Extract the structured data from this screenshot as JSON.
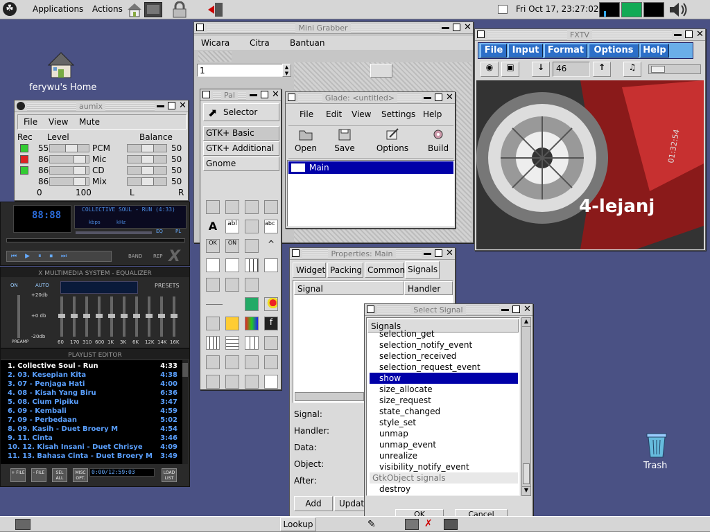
{
  "top_panel": {
    "applications": "Applications",
    "actions": "Actions",
    "clock": "Fri Oct 17, 23:27:02"
  },
  "desktop": {
    "home_label": "ferywu's Home",
    "trash_label": "Trash"
  },
  "aumix": {
    "title": "aumix",
    "menu": [
      "File",
      "View",
      "Mute"
    ],
    "headers": {
      "rec": "Rec",
      "level": "Level",
      "balance": "Balance"
    },
    "channels": [
      {
        "level": "55",
        "name": "PCM",
        "balance": "50"
      },
      {
        "level": "86",
        "name": "Mic",
        "balance": "50"
      },
      {
        "level": "86",
        "name": "CD",
        "balance": "50"
      },
      {
        "level": "86",
        "name": "Mix",
        "balance": "50"
      }
    ],
    "scale": {
      "min": "0",
      "max": "100",
      "left": "L",
      "right": "R"
    }
  },
  "xmms": {
    "song": "COLLECTIVE SOUL - RUN (4:33)",
    "kbps": "kbps",
    "khz": "kHz",
    "eq": "EQ",
    "pl": "PL",
    "band": "BAND",
    "rep": "REP",
    "eq_title": "X MULTIMEDIA SYSTEM - EQUALIZER",
    "on": "ON",
    "auto": "AUTO",
    "presets": "PRESETS",
    "db_top": "+20db",
    "db_mid": "+0 db",
    "db_bot": "-20db",
    "preamp": "PREAMP",
    "bands": [
      "60",
      "170",
      "310",
      "600",
      "1K",
      "3K",
      "6K",
      "12K",
      "14K",
      "16K"
    ],
    "pl_title": "PLAYLIST EDITOR",
    "playlist": [
      {
        "t": "1. Collective Soul - Run",
        "d": "4:33"
      },
      {
        "t": "2. 03. Kesepian Kita",
        "d": "4:38"
      },
      {
        "t": "3. 07 - Penjaga Hati",
        "d": "4:00"
      },
      {
        "t": "4. 08 - Kisah Yang Biru",
        "d": "6:36"
      },
      {
        "t": "5. 08. Cium Pipiku",
        "d": "3:47"
      },
      {
        "t": "6. 09 - Kembali",
        "d": "4:59"
      },
      {
        "t": "7. 09 - Perbedaan",
        "d": "5:02"
      },
      {
        "t": "8. 09. Kasih - Duet Broery M",
        "d": "4:54"
      },
      {
        "t": "9. 11. Cinta",
        "d": "3:46"
      },
      {
        "t": "10. 12. Kisah Insani - Duet Chrisye",
        "d": "4:09"
      },
      {
        "t": "11. 13. Bahasa Cinta - Duet Broery M",
        "d": "3:49"
      }
    ],
    "pl_buttons": [
      "+ FILE",
      "- FILE",
      "SEL ALL",
      "MISC OPT.",
      "LOAD LIST"
    ],
    "pl_time": "0:00/12:59:03"
  },
  "minigrabber": {
    "title": "Mini Grabber",
    "menu": [
      "Wicara",
      "Citra",
      "Bantuan"
    ],
    "spin": "1"
  },
  "palette": {
    "title": "Pal",
    "selector": "Selector",
    "tabs": [
      "GTK+ Basic",
      "GTK+ Additional",
      "Gnome"
    ]
  },
  "glade": {
    "title": "Glade: <untitled>",
    "menu": [
      "File",
      "Edit",
      "View",
      "Settings",
      "Help"
    ],
    "tools": [
      "Open",
      "Save",
      "Options",
      "Build"
    ],
    "tree_item": "Main"
  },
  "properties": {
    "title": "Properties: Main",
    "tabs": [
      "Widget",
      "Packing",
      "Common",
      "Signals"
    ],
    "col_signal": "Signal",
    "col_handler": "Handler",
    "fields": [
      "Signal:",
      "Handler:",
      "Data:",
      "Object:",
      "After:"
    ],
    "add": "Add",
    "update": "Update"
  },
  "select_signal": {
    "title": "Select Signal",
    "header": "Signals",
    "items": [
      "selection_get",
      "selection_notify_event",
      "selection_received",
      "selection_request_event",
      "show",
      "size_allocate",
      "size_request",
      "state_changed",
      "style_set",
      "unmap",
      "unmap_event",
      "unrealize",
      "visibility_notify_event"
    ],
    "group": "GtkObject signals",
    "after_group": "destroy",
    "ok": "OK",
    "cancel": "Cancel"
  },
  "fxtv": {
    "title": "FXTV",
    "menu": [
      "File",
      "Input",
      "Format",
      "Options",
      "Help"
    ],
    "channel": "46"
  },
  "video": {
    "overlay": "4-lejanj",
    "side_text": "01:32:54"
  },
  "bottom_panel": {
    "lookup": "Lookup"
  }
}
